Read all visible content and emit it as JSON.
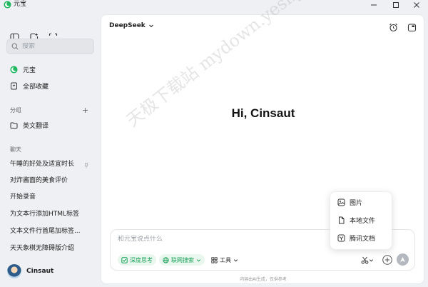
{
  "app": {
    "title": "元宝"
  },
  "search": {
    "placeholder": "搜索"
  },
  "nav": [
    {
      "label": "元宝"
    },
    {
      "label": "全部收藏"
    }
  ],
  "groups": {
    "title": "分组",
    "add_label": "+",
    "items": [
      {
        "label": "英文翻译"
      }
    ]
  },
  "chats": {
    "title": "聊天",
    "items": [
      {
        "label": "午睡的好处及适宜时长"
      },
      {
        "label": "对炸酱面的美食评价"
      },
      {
        "label": "开始录音"
      },
      {
        "label": "为文本行添加HTML标签"
      },
      {
        "label": "文本文件行首尾加标签..."
      },
      {
        "label": "天天象棋无障碍版介绍"
      }
    ]
  },
  "user": {
    "name": "Cinsaut"
  },
  "main": {
    "model": "DeepSeek",
    "greeting": "Hi, Cinsaut",
    "watermark": "天极下载站 mydown.yesky.com"
  },
  "composer": {
    "placeholder": "和元宝说点什么",
    "deep_think": "深度思考",
    "web_search": "联网搜索",
    "tools": "工具"
  },
  "attach_menu": [
    {
      "label": "图片",
      "icon": "image-icon"
    },
    {
      "label": "本地文件",
      "icon": "file-icon"
    },
    {
      "label": "腾讯文档",
      "icon": "docs-icon"
    }
  ],
  "disclaimer": "内容由AI生成，仅供参考",
  "colors": {
    "accent_green": "#18a058",
    "send_disabled": "#b4b8bf"
  }
}
